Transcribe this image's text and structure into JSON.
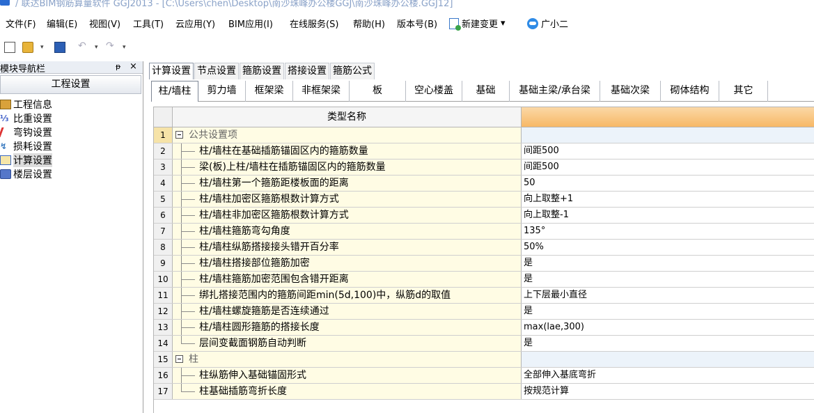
{
  "window": {
    "title": "/ 联达BIM钢筋算量软件 GGJ2013 - [C:\\Users\\chen\\Desktop\\南沙珠峰办公楼GGJ\\南沙珠峰办公楼.GGJ12]"
  },
  "menu": {
    "items": [
      "文件(F)",
      "编辑(E)",
      "视图(V)",
      "工具(T)",
      "云应用(Y)",
      "BIM应用(I)",
      "在线服务(S)",
      "帮助(H)",
      "版本号(B)"
    ],
    "new_change": "新建变更",
    "new_change_arrow": "▾",
    "assistant": "广小二"
  },
  "toolbar": {
    "dropdown_glyph": "▾",
    "undo_glyph": "↶",
    "redo_glyph": "↷"
  },
  "nav": {
    "title": "模块导航栏",
    "pin": "ᵽ",
    "close": "×",
    "header": "工程设置",
    "items": [
      {
        "label": "工程信息",
        "icon": "info-icon"
      },
      {
        "label": "比重设置",
        "icon": "ratio-icon"
      },
      {
        "label": "弯钩设置",
        "icon": "hook-icon"
      },
      {
        "label": "损耗设置",
        "icon": "loss-icon"
      },
      {
        "label": "计算设置",
        "icon": "calc-icon",
        "selected": true
      },
      {
        "label": "楼层设置",
        "icon": "floor-icon"
      }
    ]
  },
  "top_tabs": [
    "计算设置",
    "节点设置",
    "箍筋设置",
    "搭接设置",
    "箍筋公式"
  ],
  "sub_tabs": [
    "柱/墙柱",
    "剪力墙",
    "框架梁",
    "非框架梁",
    "板",
    "空心楼盖",
    "基础",
    "基础主梁/承台梁",
    "基础次梁",
    "砌体结构",
    "其它"
  ],
  "grid": {
    "header_name": "类型名称",
    "rows": [
      {
        "num": "1",
        "name": "公共设置项",
        "value": "",
        "group": true
      },
      {
        "num": "2",
        "name": "柱/墙柱在基础插筋锚固区内的箍筋数量",
        "value": "间距500"
      },
      {
        "num": "3",
        "name": "梁(板)上柱/墙柱在插筋锚固区内的箍筋数量",
        "value": "间距500"
      },
      {
        "num": "4",
        "name": "柱/墙柱第一个箍筋距楼板面的距离",
        "value": "50"
      },
      {
        "num": "5",
        "name": "柱/墙柱加密区箍筋根数计算方式",
        "value": "向上取整+1"
      },
      {
        "num": "6",
        "name": "柱/墙柱非加密区箍筋根数计算方式",
        "value": "向上取整-1"
      },
      {
        "num": "7",
        "name": "柱/墙柱箍筋弯勾角度",
        "value": "135°"
      },
      {
        "num": "8",
        "name": "柱/墙柱纵筋搭接接头错开百分率",
        "value": "50%"
      },
      {
        "num": "9",
        "name": "柱/墙柱搭接部位箍筋加密",
        "value": "是"
      },
      {
        "num": "10",
        "name": "柱/墙柱箍筋加密范围包含错开距离",
        "value": "是"
      },
      {
        "num": "11",
        "name": "绑扎搭接范围内的箍筋间距min(5d,100)中，纵筋d的取值",
        "value": "上下层最小直径"
      },
      {
        "num": "12",
        "name": "柱/墙柱螺旋箍筋是否连续通过",
        "value": "是"
      },
      {
        "num": "13",
        "name": "柱/墙柱圆形箍筋的搭接长度",
        "value": "max(lae,300)"
      },
      {
        "num": "14",
        "name": "层间变截面钢筋自动判断",
        "value": "是"
      },
      {
        "num": "15",
        "name": "柱",
        "value": "",
        "group": true
      },
      {
        "num": "16",
        "name": "柱纵筋伸入基础锚固形式",
        "value": "全部伸入基底弯折"
      },
      {
        "num": "17",
        "name": "柱基础插筋弯折长度",
        "value": "按规范计算"
      }
    ]
  }
}
